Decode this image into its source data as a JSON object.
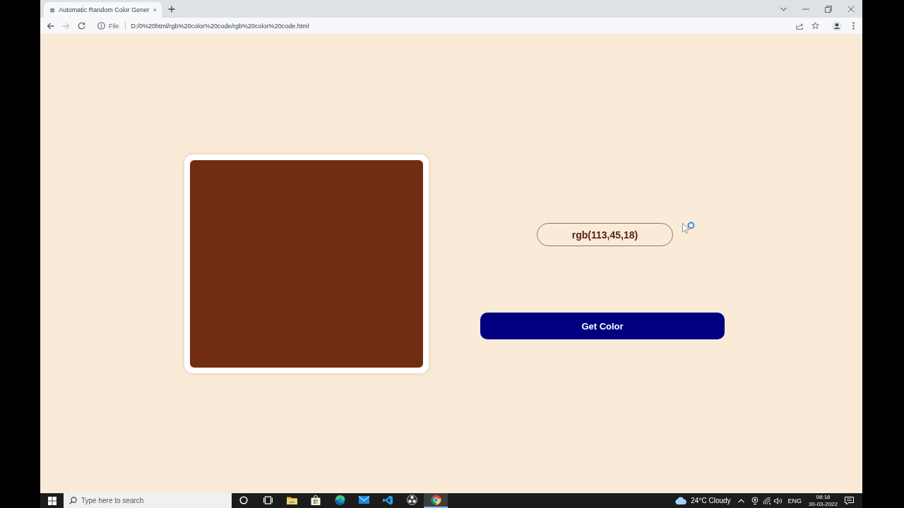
{
  "browser": {
    "tabs": [
      {
        "title": "Automatic Random Color Gener",
        "selected": true
      }
    ],
    "nav_buttons": [
      {
        "kind": "back",
        "disabled": false
      },
      {
        "kind": "forward",
        "disabled": true
      },
      {
        "kind": "reload",
        "disabled": false
      }
    ],
    "address_bar": {
      "label": "File",
      "url": "D:/0%20html/rgb%20color%20code/rgb%20color%20code.html"
    }
  },
  "page": {
    "swatch": {
      "color": "#712d12"
    },
    "color_code": "rgb(113,45,18)",
    "button": "Get Color"
  },
  "taskbar": {
    "search": {
      "placeholder": "Type here to search"
    },
    "apps": [
      {
        "kind": "cortana",
        "selected": false
      },
      {
        "kind": "task_view",
        "selected": false
      },
      {
        "kind": "explorer",
        "selected": false
      },
      {
        "kind": "store",
        "selected": false
      },
      {
        "kind": "edge",
        "selected": false
      },
      {
        "kind": "mail",
        "selected": false
      },
      {
        "kind": "vscode",
        "selected": false
      },
      {
        "kind": "obs",
        "selected": false
      },
      {
        "kind": "chrome",
        "selected": true
      }
    ],
    "weather": "24°C Cloudy",
    "language": "ENG",
    "time": "08:18",
    "date": "30-03-2022"
  }
}
